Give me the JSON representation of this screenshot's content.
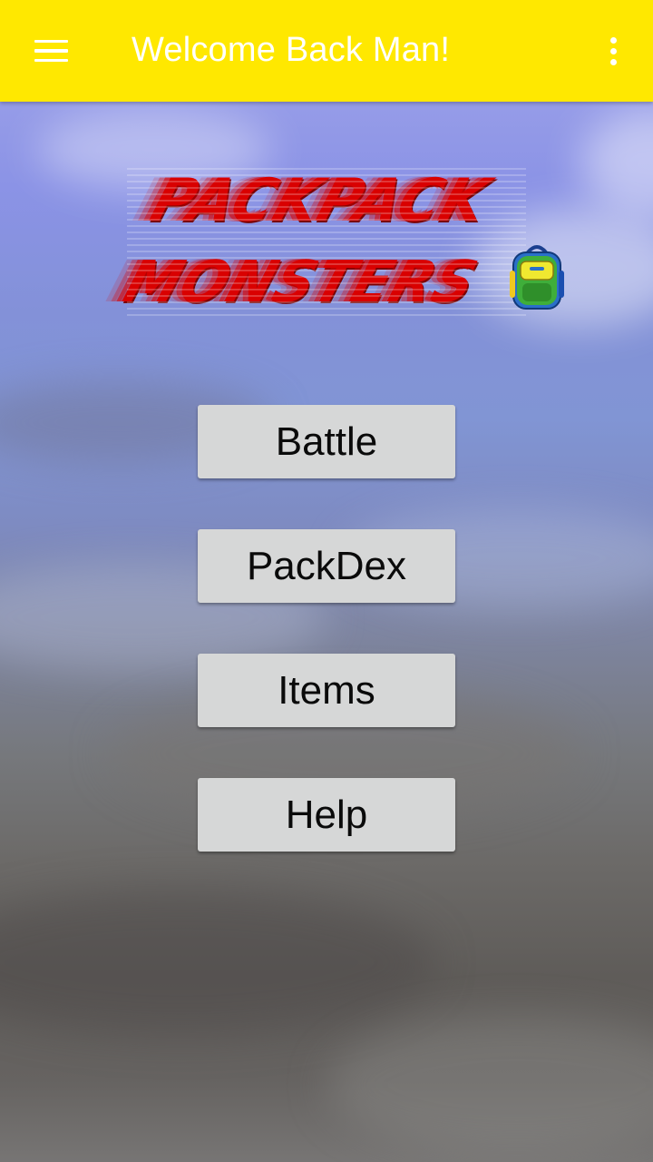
{
  "app_bar": {
    "menu_icon": "hamburger-menu-icon",
    "title": "Welcome Back Man!",
    "overflow_icon": "more-vert-icon",
    "background_color": "#ffe800",
    "title_color": "#ffffff"
  },
  "logo": {
    "line1": "PACKPACK",
    "line2": "MONSTERS",
    "icon": "backpack-icon",
    "text_color": "#d90000"
  },
  "menu": {
    "buttons": [
      {
        "label": "Battle"
      },
      {
        "label": "PackDex"
      },
      {
        "label": "Items"
      },
      {
        "label": "Help"
      }
    ],
    "button_color": "#d6d7d7"
  }
}
